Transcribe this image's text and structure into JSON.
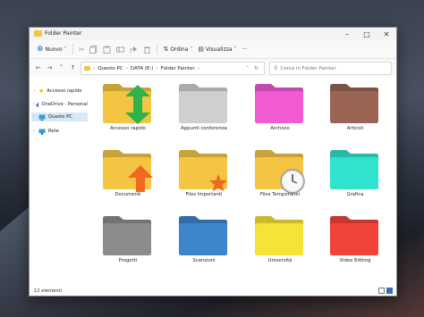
{
  "window": {
    "title": "Folder Painter"
  },
  "toolbar": {
    "new_label": "Nuovo",
    "sort_label": "Ordina",
    "view_label": "Visualizza",
    "more_label": "···"
  },
  "address": {
    "segments": [
      "Questo PC",
      "DATA (E:)",
      "Folder Painter"
    ]
  },
  "search": {
    "placeholder": "Cerca in Folder Painter"
  },
  "sidebar": {
    "items": [
      {
        "label": "Accesso rapido"
      },
      {
        "label": "OneDrive - Personal"
      },
      {
        "label": "Questo PC"
      },
      {
        "label": "Rete"
      }
    ]
  },
  "folders": [
    {
      "label": "Accesso rapido",
      "color": "#f4c542",
      "badge": "updown-arrow"
    },
    {
      "label": "Appunti conferenza",
      "color": "#cfcfcf",
      "badge": ""
    },
    {
      "label": "Archivio",
      "color": "#f25ad4",
      "badge": ""
    },
    {
      "label": "Articoli",
      "color": "#9a6552",
      "badge": ""
    },
    {
      "label": "Documenti",
      "color": "#f4c542",
      "badge": "up-arrow"
    },
    {
      "label": "Files Importanti",
      "color": "#f4c542",
      "badge": "star"
    },
    {
      "label": "Files Temporanei",
      "color": "#f4c542",
      "badge": "clock"
    },
    {
      "label": "Grafica",
      "color": "#2fe3cf",
      "badge": ""
    },
    {
      "label": "Progetti",
      "color": "#8c8c8c",
      "badge": ""
    },
    {
      "label": "Scansioni",
      "color": "#3c86cc",
      "badge": ""
    },
    {
      "label": "Università",
      "color": "#f7e236",
      "badge": ""
    },
    {
      "label": "Video Editing",
      "color": "#f2433a",
      "badge": ""
    }
  ],
  "status": {
    "count": "12 elementi"
  }
}
